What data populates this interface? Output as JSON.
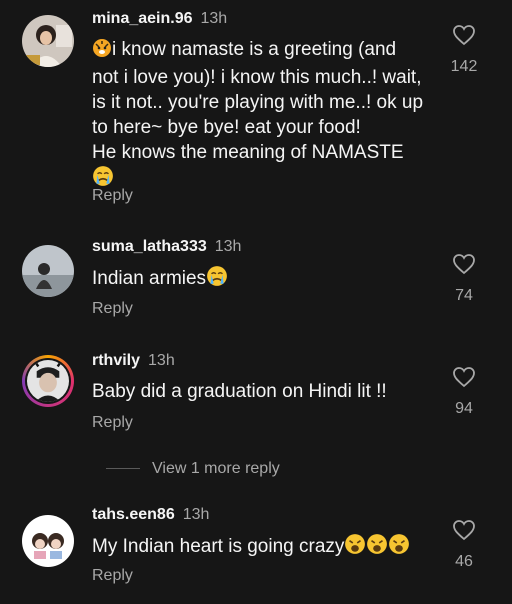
{
  "comments": [
    {
      "username": "mina_aein.96",
      "time": "13h",
      "text_lines": [
        "i know namaste is a greeting (and",
        "not i love you)! i know this much..! wait,",
        "is it not.. you're playing with me..! ok up",
        "to here~ bye bye! eat your food!",
        "He knows the meaning of NAMASTE"
      ],
      "reply_label": "Reply",
      "likes": "142"
    },
    {
      "username": "suma_latha333",
      "time": "13h",
      "text": "Indian armies",
      "reply_label": "Reply",
      "likes": "74"
    },
    {
      "username": "rthvily",
      "time": "13h",
      "text": "Baby did a graduation on Hindi lit !!",
      "reply_label": "Reply",
      "likes": "94"
    },
    {
      "username": "tahs.een86",
      "time": "13h",
      "text": "My Indian heart is going crazy",
      "reply_label": "Reply",
      "likes": "46"
    }
  ],
  "view_more": "View 1 more reply",
  "icons": [
    "heart-icon",
    "tiger-emoji",
    "crying-emoji",
    "weary-emoji"
  ],
  "colors": {
    "background": "#161616",
    "secondary_text": "#a8a8a8",
    "emoji_yellow": "#f7c531"
  }
}
